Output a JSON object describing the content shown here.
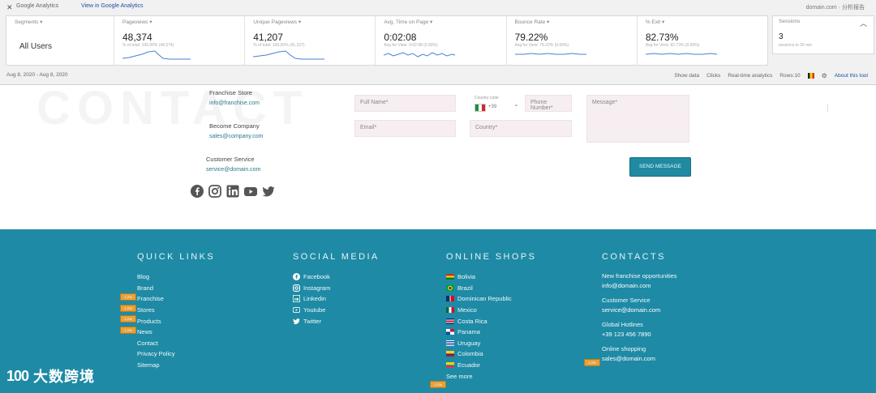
{
  "ga": {
    "top_left": "Google Analytics",
    "view_link": "View in Google Analytics",
    "top_right": "domain.com · 分析报告",
    "segment": {
      "label": "Segments ▾",
      "name": "All Users"
    },
    "metrics": [
      {
        "label": "Pageviews ▾",
        "value": "48,374",
        "sub": "% of total: 100.00% (48,374)"
      },
      {
        "label": "Unique Pageviews ▾",
        "value": "41,207",
        "sub": "% of total: 100.00% (41,207)"
      },
      {
        "label": "Avg. Time on Page ▾",
        "value": "0:02:08",
        "sub": "Avg for View: 0:02:08 (0.00%)"
      },
      {
        "label": "Bounce Rate ▾",
        "value": "79.22%",
        "sub": "Avg for View: 79.22% (0.00%)"
      },
      {
        "label": "% Exit ▾",
        "value": "82.73%",
        "sub": "Avg for View: 82.73% (0.00%)"
      }
    ],
    "side": {
      "label": "Sessions",
      "value": "3",
      "sub": "sessions in 30 min"
    },
    "date_range": "Aug 8, 2020 - Aug 8, 2020",
    "bottom_items": [
      "Show data",
      "Clicks",
      "Real-time analytics",
      "Rows:10"
    ],
    "bottom_link": "About this tool",
    "colors": {
      "sparkline": "#4a7fd1",
      "link": "#1a4fa0"
    }
  },
  "contact": {
    "watermark": "CONTACT",
    "blocks": [
      {
        "title": "Franchise Store",
        "link": "info@franchise.com"
      },
      {
        "title": "Become Company",
        "link": "sales@company.com"
      },
      {
        "title": "Customer Service",
        "link": "service@domain.com"
      }
    ],
    "fields": {
      "full_name": "Full Name*",
      "email": "Email*",
      "code_label": "Country code",
      "code_value": "+39",
      "phone": "Phone Number*",
      "country": "Country*",
      "message": "Message*"
    },
    "submit_label": "SEND MESSAGE",
    "social_icons": [
      "facebook-icon",
      "instagram-icon",
      "linkedin-icon",
      "youtube-icon",
      "twitter-icon"
    ]
  },
  "footer": {
    "bg_color": "#1e8aa5",
    "quick_links": {
      "title": "QUICK LINKS",
      "items": [
        "Blog",
        "Brand",
        "Franchise",
        "Stores",
        "Products",
        "News",
        "Contact",
        "Privacy Policy",
        "Sitemap"
      ]
    },
    "social_media": {
      "title": "SOCIAL MEDIA",
      "items": [
        {
          "icon": "facebook-icon",
          "label": "Facebook"
        },
        {
          "icon": "instagram-icon",
          "label": "Instagram"
        },
        {
          "icon": "linkedin-icon",
          "label": "Linkedin"
        },
        {
          "icon": "youtube-icon",
          "label": "Youtube"
        },
        {
          "icon": "twitter-icon",
          "label": "Twitter"
        }
      ]
    },
    "online_shops": {
      "title": "ONLINE SHOPS",
      "items": [
        {
          "label": "Bolivia",
          "flag": "bolivia"
        },
        {
          "label": "Brazil",
          "flag": "brazil"
        },
        {
          "label": "Dominican Republic",
          "flag": "dominican"
        },
        {
          "label": "Mexico",
          "flag": "mexico"
        },
        {
          "label": "Costa Rica",
          "flag": "costa-rica"
        },
        {
          "label": "Panama",
          "flag": "panama"
        },
        {
          "label": "Uruguay",
          "flag": "uruguay"
        },
        {
          "label": "Colombia",
          "flag": "colombia"
        },
        {
          "label": "Ecuador",
          "flag": "ecuador"
        },
        {
          "label": "See more",
          "flag": ""
        }
      ]
    },
    "contacts": {
      "title": "CONTACTS",
      "items": [
        {
          "label": "New franchise opportunities",
          "value": "info@domain.com"
        },
        {
          "label": "Customer Service",
          "value": "service@domain.com"
        },
        {
          "label": "Global Hotlines",
          "value": "+39 123 456 7890"
        },
        {
          "label": "Online shopping",
          "value": "sales@domain.com"
        }
      ]
    },
    "badge_text": "1.2%"
  },
  "brand": {
    "mark": "100",
    "name": "大数跨境"
  }
}
